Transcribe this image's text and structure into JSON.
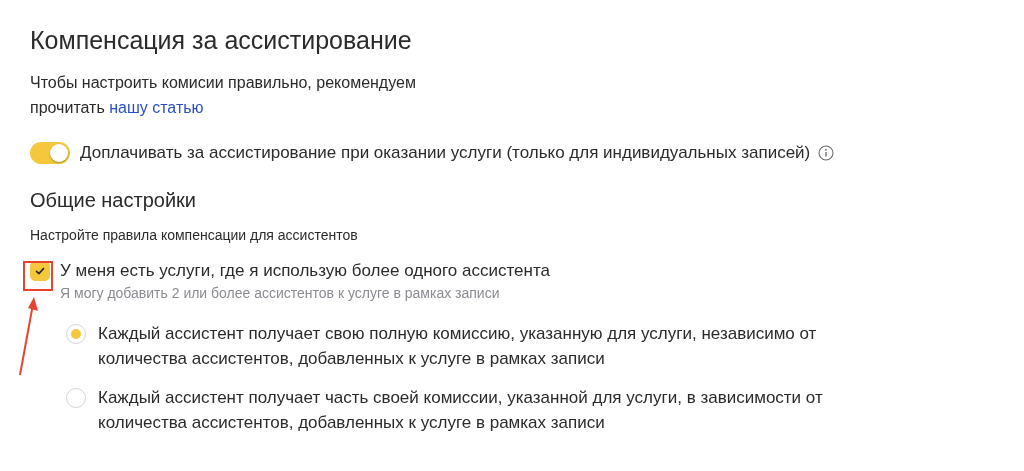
{
  "title": "Компенсация за ассистирование",
  "intro": {
    "text": "Чтобы настроить комисии правильно, рекомендуем прочитать",
    "link": "нашу статью"
  },
  "toggle": {
    "label": "Доплачивать за ассистирование при оказании услуги (только для индивидуальных записей)",
    "on": true
  },
  "section": {
    "title": "Общие настройки",
    "subtitle": "Настройте правила компенсации для ассистентов"
  },
  "checkbox": {
    "label": "У меня есть услуги, где я использую более одного ассистента",
    "hint": "Я могу добавить 2 или более ассистентов к услуге в рамках записи",
    "checked": true
  },
  "options": [
    {
      "label": "Каждый ассистент получает свою полную комиссию, указанную для услуги, независимо от количества ассистентов, добавленных к услуге в рамках записи",
      "selected": true
    },
    {
      "label": "Каждый ассистент получает часть своей комиссии, указанной для услуги, в зависимости от количества ассистентов, добавленных к услуге в рамках записи",
      "selected": false
    }
  ]
}
